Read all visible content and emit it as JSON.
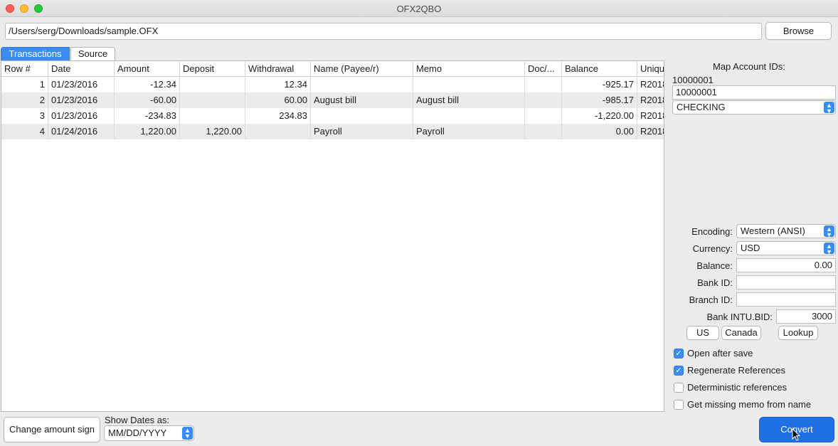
{
  "window": {
    "title": "OFX2QBO"
  },
  "path": {
    "value": "/Users/serg/Downloads/sample.OFX",
    "browse_label": "Browse"
  },
  "tabs": [
    {
      "label": "Transactions",
      "active": true
    },
    {
      "label": "Source",
      "active": false
    }
  ],
  "table": {
    "columns": [
      "Row #",
      "Date",
      "Amount",
      "Deposit",
      "Withdrawal",
      "Name (Payee/r)",
      "Memo",
      "Doc/...",
      "Balance",
      "Uniqu"
    ],
    "rows": [
      {
        "row": "1",
        "date": "01/23/2016",
        "amount": "-12.34",
        "deposit": "",
        "withdrawal": "12.34",
        "name": "",
        "memo": "",
        "doc": "",
        "balance": "-925.17",
        "unique": "R2018"
      },
      {
        "row": "2",
        "date": "01/23/2016",
        "amount": "-60.00",
        "deposit": "",
        "withdrawal": "60.00",
        "name": "August bill",
        "memo": "August bill",
        "doc": "",
        "balance": "-985.17",
        "unique": "R2018"
      },
      {
        "row": "3",
        "date": "01/23/2016",
        "amount": "-234.83",
        "deposit": "",
        "withdrawal": "234.83",
        "name": "",
        "memo": "",
        "doc": "",
        "balance": "-1,220.00",
        "unique": "R2018"
      },
      {
        "row": "4",
        "date": "01/24/2016",
        "amount": "1,220.00",
        "deposit": "1,220.00",
        "withdrawal": "",
        "name": "Payroll",
        "memo": "Payroll",
        "doc": "",
        "balance": "0.00",
        "unique": "R2018"
      }
    ]
  },
  "account_map": {
    "label": "Map Account IDs:",
    "source_id": "10000001",
    "target_id": "10000001",
    "account_type": "CHECKING"
  },
  "settings": {
    "encoding_label": "Encoding:",
    "encoding_value": "Western (ANSI)",
    "currency_label": "Currency:",
    "currency_value": "USD",
    "balance_label": "Balance:",
    "balance_value": "0.00",
    "bank_id_label": "Bank ID:",
    "bank_id_value": "",
    "branch_id_label": "Branch ID:",
    "branch_id_value": "",
    "intu_bid_label": "Bank INTU.BID:",
    "intu_bid_value": "3000",
    "us_label": "US",
    "canada_label": "Canada",
    "lookup_label": "Lookup"
  },
  "options": [
    {
      "label": "Open after save",
      "checked": true
    },
    {
      "label": "Regenerate References",
      "checked": true
    },
    {
      "label": "Deterministic references",
      "checked": false
    },
    {
      "label": "Get missing memo from name",
      "checked": false
    }
  ],
  "footer": {
    "change_sign_label": "Change amount sign",
    "show_dates_label": "Show Dates as:",
    "date_format": "MM/DD/YYYY",
    "convert_label": "Convert"
  },
  "colors": {
    "accent": "#3a8cf0",
    "convert": "#1f6fe5",
    "row_alt": "#ebebeb"
  },
  "icons": [
    "close-window-icon",
    "minimize-window-icon",
    "zoom-window-icon",
    "select-arrows-icon",
    "checkmark-icon",
    "mouse-pointer-icon"
  ]
}
